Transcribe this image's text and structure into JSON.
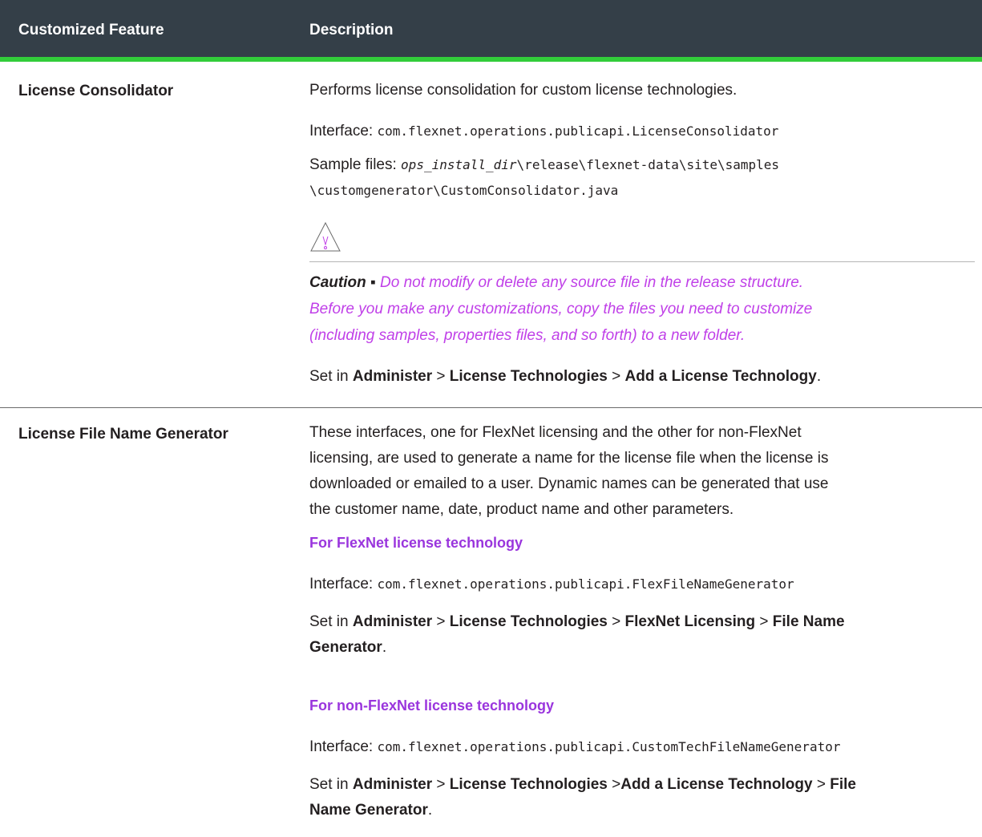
{
  "table": {
    "headers": {
      "feature": "Customized Feature",
      "description": "Description"
    },
    "rows": [
      {
        "feature": "License Consolidator",
        "intro": "Performs license consolidation for custom license technologies.",
        "interface_label": "Interface: ",
        "interface_value": "com.flexnet.operations.publicapi.LicenseConsolidator",
        "sample_label": "Sample files: ",
        "sample_italic": "ops_install_dir",
        "sample_path1": "\\release\\flexnet-data\\site\\samples",
        "sample_path2": "\\customgenerator\\CustomConsolidator.java",
        "warning_icon": "warning-triangle-icon",
        "caution_lead": "Caution ▪ ",
        "caution_line1": "Do not modify or delete any source file in the release structure.",
        "caution_line2": "Before you make any customizations, copy the files you need to customize",
        "caution_line3": "(including samples, properties files, and so forth) to a new folder.",
        "set_in": {
          "prefix": "Set in ",
          "p1": "Administer",
          "sep1": " > ",
          "p2": "License Technologies",
          "sep2": " > ",
          "p3": "Add a License Technology",
          "end": "."
        }
      },
      {
        "feature": "License File Name Generator",
        "intro_lines": [
          "These interfaces, one for FlexNet licensing and the other for non-FlexNet",
          "licensing, are used to generate a name for the license file when the license is",
          "downloaded or emailed to a user. Dynamic names can be generated that use",
          "the customer name, date, product name and other parameters."
        ],
        "flexnet_heading": "For FlexNet license technology",
        "flexnet_interface_label": "Interface: ",
        "flexnet_interface_value": "com.flexnet.operations.publicapi.FlexFileNameGenerator",
        "flexnet_set_in": {
          "prefix": "Set in ",
          "p1": "Administer",
          "sep1": " > ",
          "p2": "License Technologies",
          "sep2": " > ",
          "p3": "FlexNet Licensing",
          "sep3": " > ",
          "p4a": "File Name",
          "p4b": "Generator",
          "end": "."
        },
        "nonflex_heading": "For non-FlexNet license technology",
        "nonflex_interface_label": "Interface: ",
        "nonflex_interface_value": "com.flexnet.operations.publicapi.CustomTechFileNameGenerator",
        "nonflex_set_in": {
          "prefix": "Set in ",
          "p1": "Administer",
          "sep1": " > ",
          "p2": "License Technologies",
          "sep2": " >",
          "p3": "Add a License Technology",
          "sep3": " > ",
          "p4a": "File",
          "p4b": "Name Generator",
          "end": "."
        }
      }
    ]
  },
  "colors": {
    "header_bg": "#343f48",
    "header_rule": "#32cd3a",
    "link": "#9a35dd",
    "caution": "#c040e8"
  }
}
